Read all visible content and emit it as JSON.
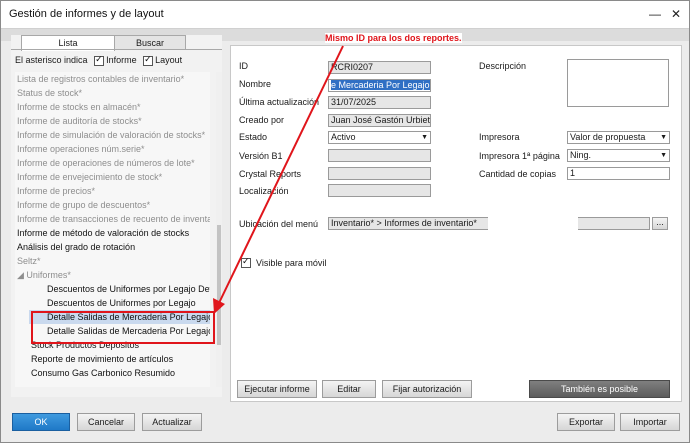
{
  "window": {
    "title": "Gestión de informes y de layout"
  },
  "left": {
    "tabs": [
      "Lista",
      "Buscar"
    ],
    "asterisk_label": "El asterisco indica",
    "informe_label": "Informe",
    "layout_label": "Layout",
    "tree": [
      "Lista de registros contables de inventario*",
      "Status de stock*",
      "Informe de stocks en almacén*",
      "Informe de auditoría de stocks*",
      "Informe de simulación de valoración de stocks*",
      "Informe operaciones núm.serie*",
      "Informe de operaciones de números de lote*",
      "Informe de envejecimiento de stock*",
      "Informe de precios*",
      "Informe de grupo de descuentos*",
      "Informe de transacciones de recuento de inventario",
      "Informe de método de valoración de stocks",
      "Análisis del grado de rotación",
      "Seltz*",
      "Uniformes*",
      "Descuentos de Uniformes por Legajo Det",
      "Descuentos de Uniformes por Legajo",
      "Detalle Salidas de Mercaderia Por Legajo",
      "Detalle Salidas de Mercaderia Por Legajo",
      "Stock Productos Depositos",
      "Reporte de movimiento de artículos",
      "Consumo Gas Carbonico Resumido"
    ]
  },
  "form": {
    "id_label": "ID",
    "id_value": "RCRI0207",
    "nombre_label": "Nombre",
    "nombre_value": "e Mercaderia Por Legajo",
    "ultima_label": "Última actualización",
    "ultima_value": "31/07/2025",
    "creado_label": "Creado por",
    "creado_value": "Juan José Gastón Urbieta",
    "estado_label": "Estado",
    "estado_value": "Activo",
    "version_label": "Versión B1",
    "crystal_label": "Crystal Reports",
    "localizacion_label": "Localización",
    "descripcion_label": "Descripción",
    "impresora_label": "Impresora",
    "impresora_value": "Valor de propuesta",
    "impresora1_label": "Impresora 1ª página",
    "impresora1_value": "Ning.",
    "copias_label": "Cantidad de copias",
    "copias_value": "1",
    "ubicacion_label": "Ubicación del menú",
    "ubicacion_value": "Inventario* > Informes de inventario*",
    "ellipsis": "...",
    "movil_label": "Visible para móvil"
  },
  "actions": {
    "ejecutar": "Ejecutar informe",
    "editar": "Editar",
    "fijar": "Fijar autorización",
    "tambien": "También es posible"
  },
  "footer": {
    "ok": "OK",
    "cancelar": "Cancelar",
    "actualizar": "Actualizar",
    "exportar": "Exportar",
    "importar": "Importar"
  },
  "annotation": "Mismo ID para los dos reportes.",
  "colors": {
    "annotation": "#e0151b",
    "selection": "#2f6fc4",
    "ok_button": "#1f79c7"
  }
}
